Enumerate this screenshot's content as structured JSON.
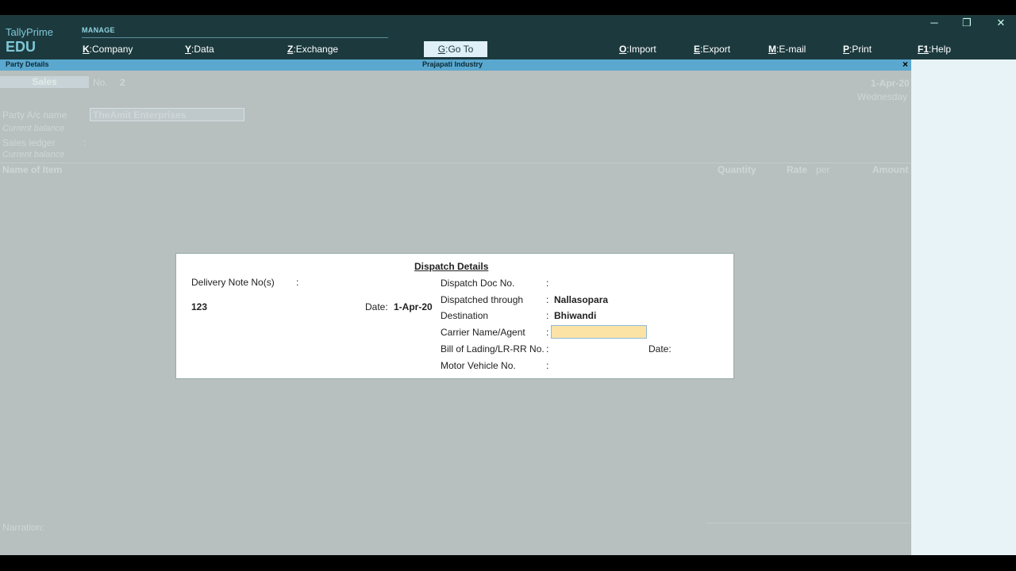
{
  "brand": {
    "line1": "TallyPrime",
    "line2": "EDU"
  },
  "menu": {
    "section_label": "MANAGE",
    "items": [
      {
        "key": "K",
        "label": "Company"
      },
      {
        "key": "Y",
        "label": "Data"
      },
      {
        "key": "Z",
        "label": "Exchange"
      },
      {
        "key": "G",
        "label": "Go To"
      },
      {
        "key": "O",
        "label": "Import"
      },
      {
        "key": "E",
        "label": "Export"
      },
      {
        "key": "M",
        "label": "E-mail"
      },
      {
        "key": "P",
        "label": "Print"
      },
      {
        "key": "F1",
        "label": "Help"
      }
    ]
  },
  "window_controls": {
    "minimize": "─",
    "restore": "❐",
    "close": "✕"
  },
  "subbar": {
    "left": "Party Details",
    "center": "Prajapati Industry",
    "close": "×"
  },
  "voucher": {
    "type": "Sales",
    "no_label": "No.",
    "no_value": "2",
    "date": "1-Apr-20",
    "day": "Wednesday",
    "party_label": "Party A/c name",
    "party_value": "TheAmit Enterprises",
    "current_balance_label": "Current balance",
    "sales_ledger_label": "Sales ledger",
    "sales_ledger_colon": ":",
    "current_balance2_label": "Current balance",
    "col_item": "Name of Item",
    "col_quantity": "Quantity",
    "col_rate": "Rate",
    "col_per": "per",
    "col_amount": "Amount",
    "narration_label": "Narration:"
  },
  "dialog": {
    "title": "Dispatch Details",
    "delivery_note_label": "Delivery Note No(s)",
    "colon": ":",
    "delivery_note_value": "123",
    "date_label": "Date:",
    "date_value": "1-Apr-20",
    "dispatch_doc_label": "Dispatch Doc No.",
    "dispatched_through_label": "Dispatched through",
    "dispatched_through_value": "Nallasopara",
    "destination_label": "Destination",
    "destination_value": "Bhiwandi",
    "carrier_label": "Carrier Name/Agent",
    "bill_label": "Bill of Lading/LR-RR No.",
    "bill_date_label": "Date:",
    "motor_label": "Motor Vehicle No."
  }
}
